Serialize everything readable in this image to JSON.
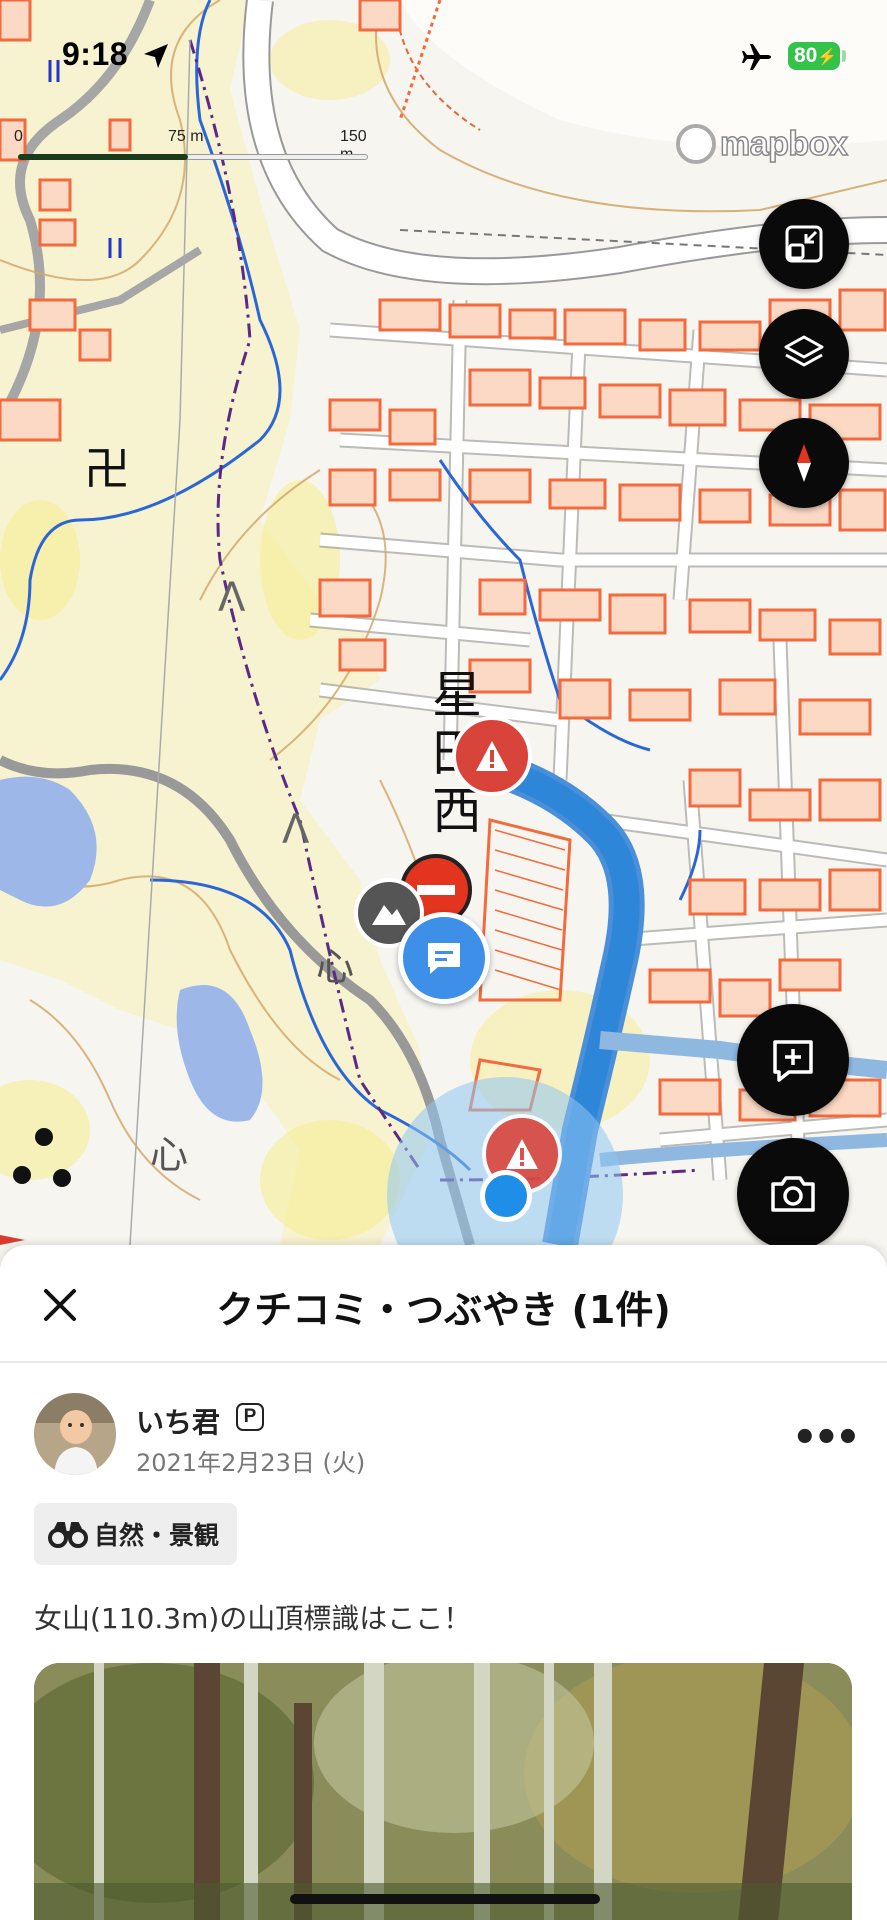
{
  "status_bar": {
    "time": "9:18",
    "battery": "80",
    "icons": [
      "location-arrow-icon",
      "airplane-icon",
      "battery-icon"
    ]
  },
  "map": {
    "scale": {
      "label_0": "0",
      "label_mid": "75 m",
      "label_max": "150 m"
    },
    "attribution": "mapbox",
    "place_name": [
      "星",
      "田",
      "西"
    ],
    "map_symbols": [
      "卍",
      "ᐱ",
      "ᐱ",
      "心",
      "心"
    ],
    "controls": [
      "collapse-icon",
      "layers-icon",
      "compass-icon",
      "add-post-icon",
      "camera-icon"
    ],
    "colors": {
      "water": "#2e86d9",
      "building_fill": "#fbd9c4",
      "building_stroke": "#f26a3d",
      "vegetation": "#f7ec8a",
      "pond": "#9db8e8"
    }
  },
  "sheet": {
    "title": "クチコミ・つぶやき (1件)",
    "post": {
      "username": "いち君",
      "badge": "P",
      "date": "2021年2月23日 (火)",
      "more": "•••",
      "tag": "自然・景観",
      "text": "女山(110.3m)の山頂標識はここ！"
    }
  }
}
